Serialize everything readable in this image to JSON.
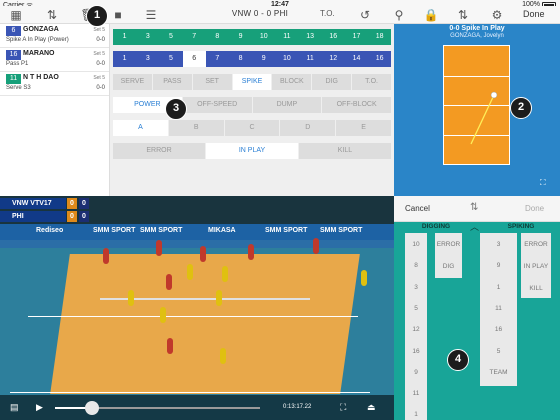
{
  "status": {
    "carrier": "Carrier ᯤ",
    "time": "12:47",
    "battery": "100%"
  },
  "topbar": {
    "title": "VNW 0 - 0 PHI",
    "to": "T.O.",
    "done": "Done"
  },
  "events": [
    {
      "num": "6",
      "num_color": "#3a55b5",
      "name": "GONZAGA",
      "desc": "Spike A In Play (Power)",
      "set": "Set 5",
      "score": "0-0"
    },
    {
      "num": "16",
      "num_color": "#3a55b5",
      "name": "MARANO",
      "desc": "Pass P1",
      "set": "Set 5",
      "score": "0-0"
    },
    {
      "num": "11",
      "num_color": "#17a07a",
      "name": "N T H DAO",
      "desc": "Serve S3",
      "set": "Set 5",
      "score": "0-0"
    }
  ],
  "green_numbers": [
    "1",
    "3",
    "5",
    "7",
    "8",
    "9",
    "10",
    "11",
    "13",
    "16",
    "17",
    "18"
  ],
  "blue_numbers": [
    "1",
    "3",
    "5",
    "6",
    "7",
    "8",
    "9",
    "10",
    "11",
    "12",
    "14",
    "16"
  ],
  "blue_selected": "6",
  "skills": [
    "SERVE",
    "PASS",
    "SET",
    "SPIKE",
    "BLOCK",
    "DIG",
    "T.O."
  ],
  "skill_selected": "SPIKE",
  "spike_types": [
    "POWER",
    "OFF-SPEED",
    "DUMP",
    "OFF-BLOCK"
  ],
  "spike_type_selected": "POWER",
  "zones": [
    "A",
    "B",
    "C",
    "D",
    "E"
  ],
  "zone_selected": "A",
  "results": [
    "ERROR",
    "IN PLAY",
    "KILL"
  ],
  "result_selected": "IN PLAY",
  "court": {
    "title": "0-0 Spike  In Play",
    "subtitle": "GONZAGA, Jovelyn"
  },
  "video": {
    "scorebug": {
      "team1": "VNW VTV17",
      "team1_set": "0",
      "team1_pts": "0",
      "team2": "PHI",
      "team2_set": "0",
      "team2_pts": "0"
    },
    "ads": [
      "Rediseo",
      "SMM SPORT",
      "SMM SPORT",
      "MIKASA",
      "SMM SPORT",
      "SMM SPORT"
    ],
    "time": "0:13:17.22"
  },
  "selection": {
    "cancel": "Cancel",
    "done": "Done",
    "digging_header": "DIGGING",
    "spiking_header": "SPIKING",
    "digging_players": [
      "10",
      "8",
      "3",
      "5",
      "12",
      "16",
      "9",
      "11",
      "1"
    ],
    "digging_results": [
      "ERROR",
      "DIG"
    ],
    "spiking_players": [
      "3",
      "9",
      "1",
      "11",
      "16",
      "5",
      "TEAM"
    ],
    "spiking_results": [
      "ERROR",
      "IN PLAY",
      "KILL"
    ]
  },
  "callouts": [
    "1",
    "2",
    "3",
    "4"
  ],
  "colors": {
    "green": "#17a07a",
    "blue": "#3a55b5",
    "court_bg": "#2a85c8",
    "court": "#f39a22",
    "panel": "#18a598",
    "accent": "#2a7fd4"
  }
}
